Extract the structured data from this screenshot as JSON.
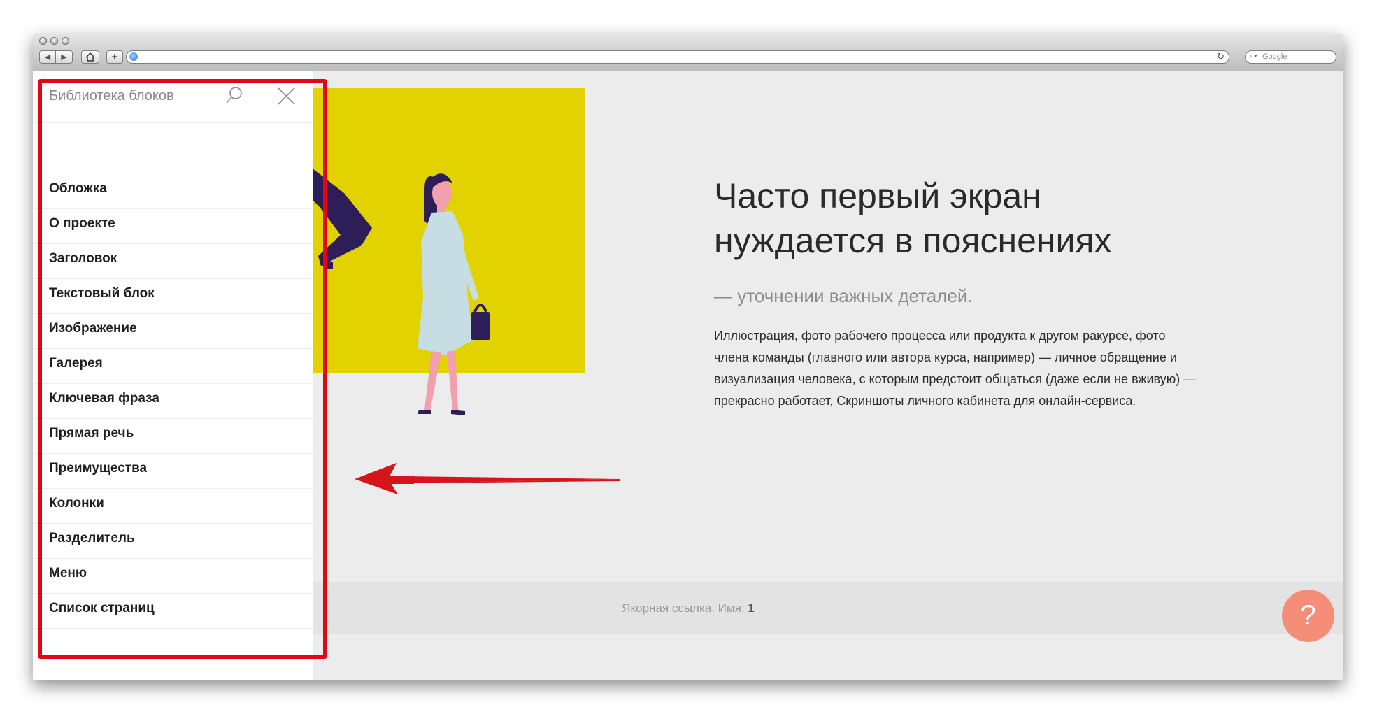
{
  "browser": {
    "search_placeholder": "Google"
  },
  "hero": {
    "title": "Часто первый экран нуждается в пояснениях",
    "subtitle": "— уточнении важных деталей.",
    "body": "Иллюстрация, фото рабочего процесса или продукта к другом ракурсе, фото члена команды (главного или автора курса, например) — личное обращение и визуализация человека, с которым предстоит общаться (даже если не вживую) — прекрасно работает, Скриншоты личного кабинета для онлайн-сервиса."
  },
  "anchor": {
    "label": "Якорная ссылка. Имя:",
    "name": "1"
  },
  "help": {
    "label": "?"
  },
  "block_library": {
    "title": "Библиотека блоков",
    "items": [
      {
        "label": "Обложка"
      },
      {
        "label": "О проекте"
      },
      {
        "label": "Заголовок"
      },
      {
        "label": "Текстовый блок"
      },
      {
        "label": "Изображение"
      },
      {
        "label": "Галерея"
      },
      {
        "label": "Ключевая фраза"
      },
      {
        "label": "Прямая речь"
      },
      {
        "label": "Преимущества"
      },
      {
        "label": "Колонки"
      },
      {
        "label": "Разделитель"
      },
      {
        "label": "Меню"
      },
      {
        "label": "Список страниц"
      }
    ]
  },
  "colors": {
    "highlight": "#e30613",
    "illustration_background": "#e2d200",
    "help_button": "#f48e78",
    "page_background": "#ececec"
  }
}
